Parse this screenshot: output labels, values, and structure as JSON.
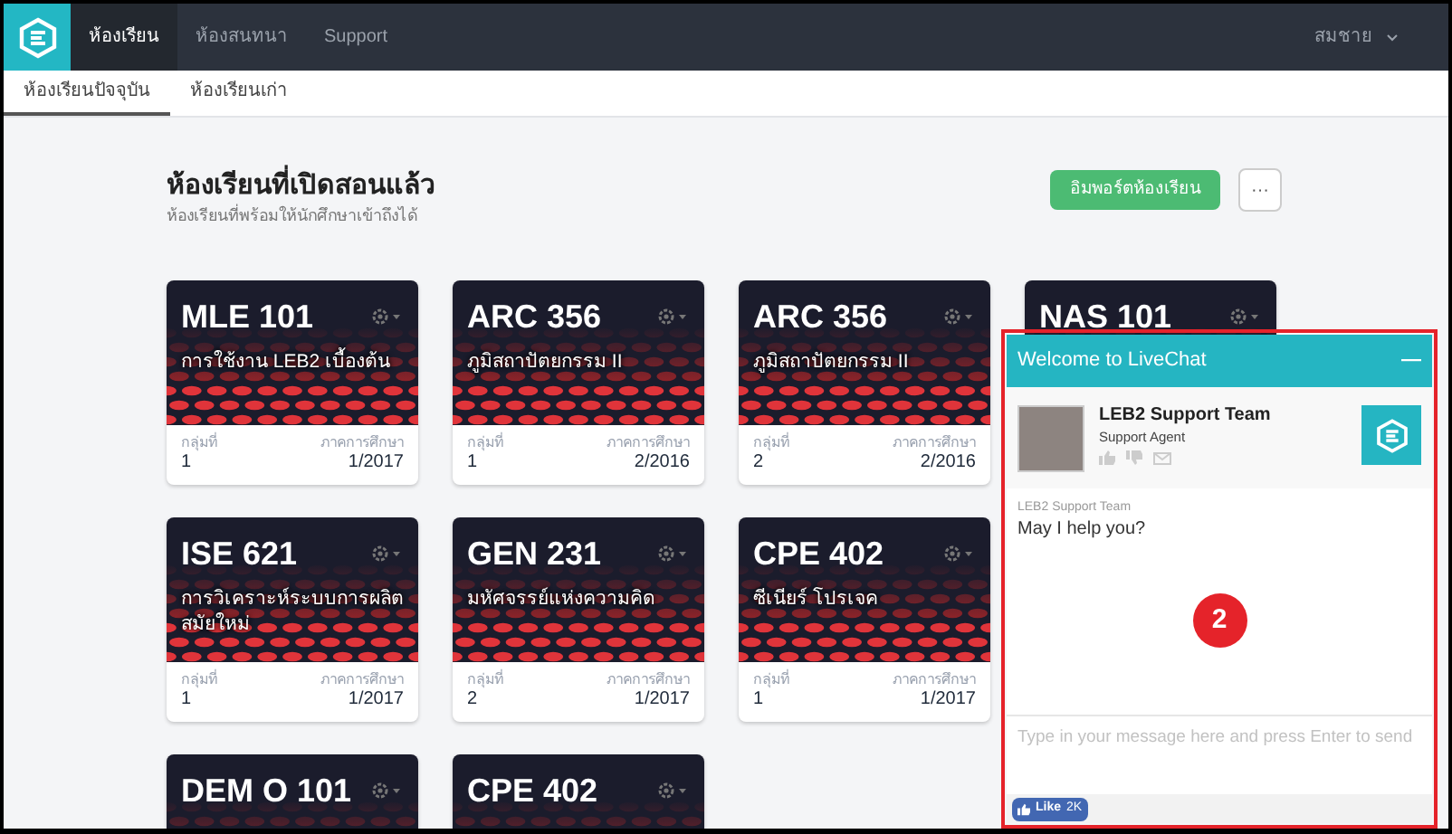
{
  "nav": {
    "tabs": [
      {
        "label": "ห้องเรียน",
        "selected": true
      },
      {
        "label": "ห้องสนทนา",
        "selected": false
      },
      {
        "label": "Support",
        "selected": false
      }
    ],
    "user": "สมชาย"
  },
  "subtabs": [
    {
      "label": "ห้องเรียนปัจจุบัน",
      "selected": true
    },
    {
      "label": "ห้องเรียนเก่า",
      "selected": false
    }
  ],
  "section": {
    "title": "ห้องเรียนที่เปิดสอนแล้ว",
    "subtitle": "ห้องเรียนที่พร้อมให้นักศึกษาเข้าถึงได้",
    "import_button": "อิมพอร์ตห้องเรียน",
    "more_button": "···"
  },
  "course_rows": [
    [
      {
        "code": "MLE 101",
        "name": "การใช้งาน LEB2 เบื้องต้น",
        "group_label": "กลุ่มที่",
        "group": "1",
        "term_label": "ภาคการศึกษา",
        "term": "1/2017"
      },
      {
        "code": "ARC 356",
        "name": "ภูมิสถาปัตยกรรม II",
        "group_label": "กลุ่มที่",
        "group": "1",
        "term_label": "ภาคการศึกษา",
        "term": "2/2016"
      },
      {
        "code": "ARC 356",
        "name": "ภูมิสถาปัตยกรรม II",
        "group_label": "กลุ่มที่",
        "group": "2",
        "term_label": "ภาคการศึกษา",
        "term": "2/2016"
      },
      {
        "code": "NAS 101"
      }
    ],
    [
      {
        "code": "ISE 621",
        "name": "การวิเคราะห์ระบบการผลิตสมัยใหม่",
        "group_label": "กลุ่มที่",
        "group": "1",
        "term_label": "ภาคการศึกษา",
        "term": "1/2017"
      },
      {
        "code": "GEN 231",
        "name": "มหัศจรรย์แห่งความคิด",
        "group_label": "กลุ่มที่",
        "group": "2",
        "term_label": "ภาคการศึกษา",
        "term": "1/2017"
      },
      {
        "code": "CPE 402",
        "name": "ซีเนียร์ โปรเจค",
        "group_label": "กลุ่มที่",
        "group": "1",
        "term_label": "ภาคการศึกษา",
        "term": "1/2017"
      }
    ],
    [
      {
        "code": "DEM O 101"
      },
      {
        "code": "CPE 402"
      }
    ]
  ],
  "chat": {
    "title": "Welcome to LiveChat",
    "minimize": "—",
    "agent_name": "LEB2 Support Team",
    "agent_role": "Support Agent",
    "message_sender": "LEB2 Support Team",
    "message": "May I help you?",
    "annotation": "2",
    "input": {
      "placeholder": "Type in your message here and press Enter to send"
    },
    "like_label": "Like",
    "like_count": "2K"
  }
}
